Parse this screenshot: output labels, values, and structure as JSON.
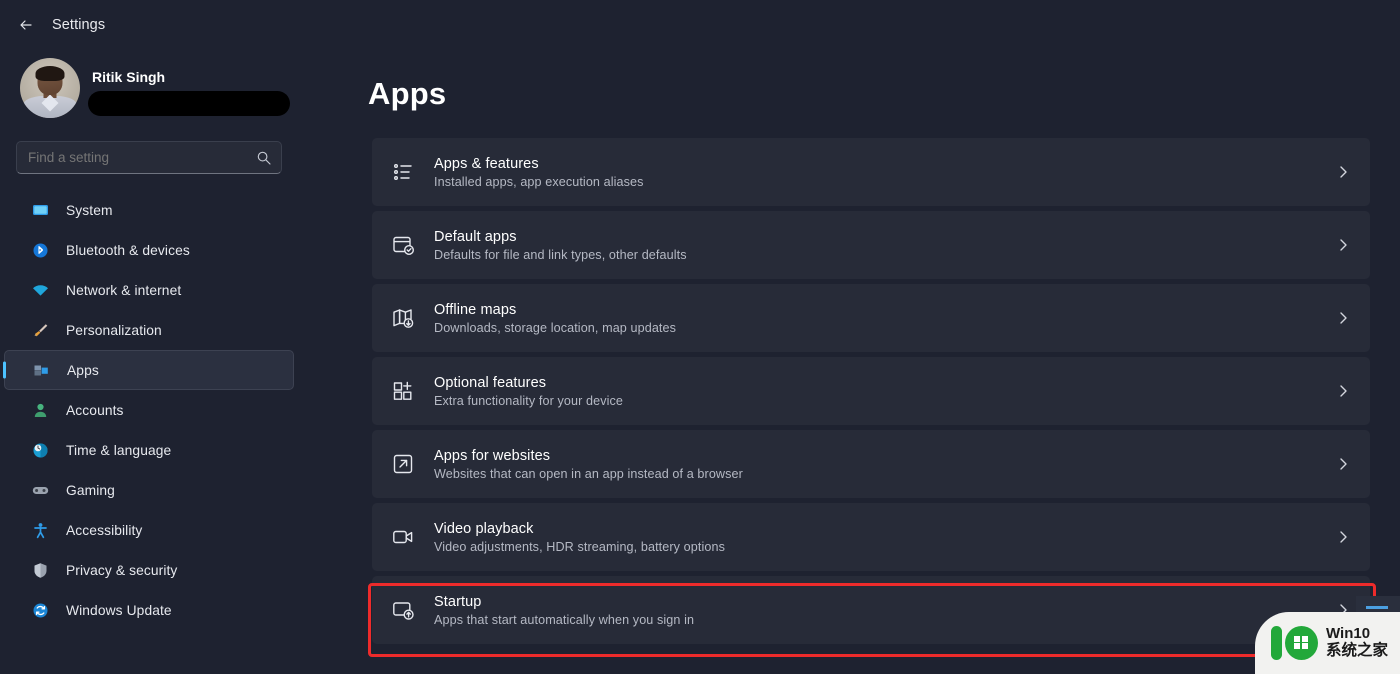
{
  "window": {
    "app_title": "Settings",
    "back_icon": "arrow-left-icon"
  },
  "sidebar": {
    "account": {
      "name": "Ritik Singh",
      "email_redacted": true,
      "avatar_icon": "user-avatar-photo"
    },
    "search": {
      "placeholder": "Find a setting",
      "value": "",
      "icon": "search-icon"
    },
    "items": [
      {
        "label": "System",
        "icon": "system-display-icon",
        "selected": false
      },
      {
        "label": "Bluetooth & devices",
        "icon": "bluetooth-icon",
        "selected": false
      },
      {
        "label": "Network & internet",
        "icon": "wifi-icon",
        "selected": false
      },
      {
        "label": "Personalization",
        "icon": "paintbrush-icon",
        "selected": false
      },
      {
        "label": "Apps",
        "icon": "apps-icon",
        "selected": true
      },
      {
        "label": "Accounts",
        "icon": "account-person-icon",
        "selected": false
      },
      {
        "label": "Time & language",
        "icon": "clock-globe-icon",
        "selected": false
      },
      {
        "label": "Gaming",
        "icon": "gamepad-icon",
        "selected": false
      },
      {
        "label": "Accessibility",
        "icon": "accessibility-icon",
        "selected": false
      },
      {
        "label": "Privacy & security",
        "icon": "shield-icon",
        "selected": false
      },
      {
        "label": "Windows Update",
        "icon": "windows-update-icon",
        "selected": false
      }
    ]
  },
  "main": {
    "page_title": "Apps",
    "cards": [
      {
        "title": "Apps & features",
        "subtitle": "Installed apps, app execution aliases",
        "icon": "bulleted-list-icon",
        "chevron": "chevron-right-icon",
        "highlighted": false
      },
      {
        "title": "Default apps",
        "subtitle": "Defaults for file and link types, other defaults",
        "icon": "window-check-icon",
        "chevron": "chevron-right-icon",
        "highlighted": false
      },
      {
        "title": "Offline maps",
        "subtitle": "Downloads, storage location, map updates",
        "icon": "map-download-icon",
        "chevron": "chevron-right-icon",
        "highlighted": false
      },
      {
        "title": "Optional features",
        "subtitle": "Extra functionality for your device",
        "icon": "grid-plus-icon",
        "chevron": "chevron-right-icon",
        "highlighted": false
      },
      {
        "title": "Apps for websites",
        "subtitle": "Websites that can open in an app instead of a browser",
        "icon": "external-link-icon",
        "chevron": "chevron-right-icon",
        "highlighted": false
      },
      {
        "title": "Video playback",
        "subtitle": "Video adjustments, HDR streaming, battery options",
        "icon": "video-camera-icon",
        "chevron": "chevron-right-icon",
        "highlighted": false
      },
      {
        "title": "Startup",
        "subtitle": "Apps that start automatically when you sign in",
        "icon": "startup-window-arrow-icon",
        "chevron": "chevron-right-icon",
        "highlighted": true
      }
    ]
  },
  "annotation": {
    "type": "red-rectangle-highlight",
    "target": "Startup",
    "color": "#ee2b2b"
  },
  "watermark": {
    "line1": "Win10",
    "line2": "系统之家",
    "logo_icon": "win10-green-logo"
  },
  "colors": {
    "background": "#1e2230",
    "card": "#272b38",
    "accent": "#4cc2ff",
    "highlight": "#ee2b2b",
    "text_primary": "#ffffff",
    "text_secondary": "#b5b9c4"
  }
}
